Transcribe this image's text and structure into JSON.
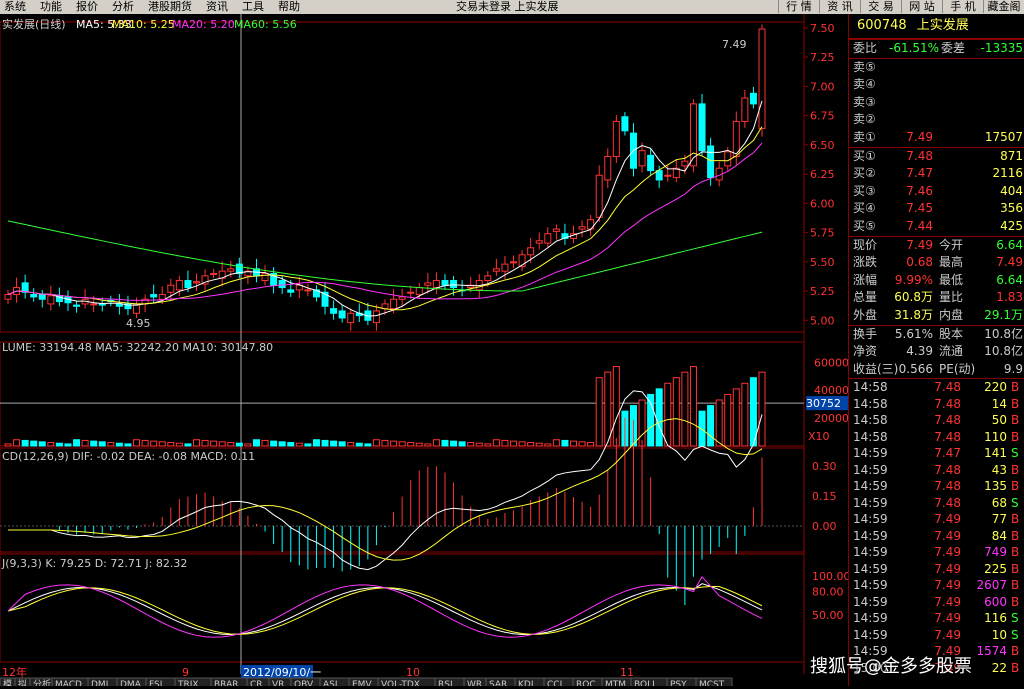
{
  "menubar": {
    "items": [
      "系统",
      "功能",
      "报价",
      "分析",
      "港股期货",
      "资讯",
      "工具",
      "帮助"
    ],
    "status": "交易未登录  上实发展",
    "right_tabs": [
      "行 情",
      "资 讯",
      "交 易",
      "网 站",
      "手 机",
      "藏金阁"
    ]
  },
  "header": {
    "price_line": "实发展(日线) MA5: 5.33  MA10: 5.25  MA20: 5.20  MA60: 5.56",
    "ma5": "MA5: 5.33",
    "ma10": "MA10: 5.25",
    "ma20": "MA20: 5.20",
    "ma60": "MA60: 5.56",
    "vol_line": "LUME: 33194.48  MA5: 32242.20  MA10: 30147.80",
    "macd_line": "CD(12,26,9)  DIF: -0.02  DEA: -0.08  MACD: 0.11",
    "kdj_line": "J(9,3,3)  K: 79.25  D: 72.71  J: 82.32"
  },
  "annotations": {
    "high_label": "7.49",
    "low_label": "4.95",
    "vol_marker": "30752",
    "vol_unit": "X10",
    "cursor_date": "2012/09/10/一"
  },
  "x_labels": [
    "12年",
    "9",
    "10",
    "11"
  ],
  "bottom_tabs": [
    "模",
    "拟",
    "分析",
    "MACD",
    "DMI",
    "DMA",
    "FSL",
    "TRIX",
    "BRAR",
    "CR",
    "VR",
    "OBV",
    "ASI",
    "EMV",
    "VOL-TDX",
    "RSI",
    "WR",
    "SAR",
    "KDJ",
    "CCI",
    "ROC",
    "MTM",
    "BOLL",
    "PSY",
    "MCST"
  ],
  "chart_data": {
    "type": "candlestick",
    "ylim": [
      4.9,
      7.55
    ],
    "yticks": [
      5.0,
      5.25,
      5.5,
      5.75,
      6.0,
      6.25,
      6.5,
      6.75,
      7.0,
      7.25,
      7.5
    ],
    "vol_ticks": [
      20000,
      40000,
      60000
    ],
    "macd_ticks": [
      0.0,
      0.15,
      0.3
    ],
    "kdj_ticks": [
      50.0,
      80.0,
      100.0
    ],
    "close": [
      5.22,
      5.28,
      5.24,
      5.2,
      5.18,
      5.21,
      5.16,
      5.15,
      5.12,
      5.18,
      5.14,
      5.13,
      5.16,
      5.12,
      5.1,
      5.14,
      5.18,
      5.2,
      5.22,
      5.3,
      5.34,
      5.28,
      5.33,
      5.38,
      5.4,
      5.42,
      5.44,
      5.4,
      5.42,
      5.38,
      5.4,
      5.3,
      5.28,
      5.24,
      5.3,
      5.26,
      5.2,
      5.12,
      5.06,
      5.02,
      5.06,
      5.04,
      5.0,
      5.08,
      5.14,
      5.18,
      5.2,
      5.24,
      5.28,
      5.32,
      5.34,
      5.3,
      5.28,
      5.26,
      5.3,
      5.34,
      5.38,
      5.44,
      5.48,
      5.5,
      5.56,
      5.62,
      5.68,
      5.74,
      5.78,
      5.7,
      5.74,
      5.8,
      5.86,
      6.24,
      6.4,
      6.7,
      6.62,
      6.3,
      6.45,
      6.28,
      6.2,
      6.24,
      6.3,
      6.36,
      6.85,
      6.45,
      6.22,
      6.3,
      6.44,
      6.7,
      6.9,
      6.85,
      7.49
    ]
  },
  "quote": {
    "code": "600748",
    "name": "上实发展",
    "weibi_label": "委比",
    "weibi": "-61.51%",
    "weicha_label": "委差",
    "weicha": "-13335",
    "sell": [
      {
        "label": "卖⑤",
        "price": "",
        "vol": ""
      },
      {
        "label": "卖④",
        "price": "",
        "vol": ""
      },
      {
        "label": "卖③",
        "price": "",
        "vol": ""
      },
      {
        "label": "卖②",
        "price": "",
        "vol": ""
      },
      {
        "label": "卖①",
        "price": "7.49",
        "vol": "17507"
      }
    ],
    "buy": [
      {
        "label": "买①",
        "price": "7.48",
        "vol": "871"
      },
      {
        "label": "买②",
        "price": "7.47",
        "vol": "2116"
      },
      {
        "label": "买③",
        "price": "7.46",
        "vol": "404"
      },
      {
        "label": "买④",
        "price": "7.45",
        "vol": "356"
      },
      {
        "label": "买⑤",
        "price": "7.44",
        "vol": "425"
      }
    ],
    "stats": [
      {
        "l1": "现价",
        "v1": "7.49",
        "l2": "今开",
        "v2": "6.64"
      },
      {
        "l1": "涨跌",
        "v1": "0.68",
        "l2": "最高",
        "v2": "7.49"
      },
      {
        "l1": "涨幅",
        "v1": "9.99%",
        "l2": "最低",
        "v2": "6.64"
      },
      {
        "l1": "总量",
        "v1": "60.8万",
        "l2": "量比",
        "v2": "1.83"
      },
      {
        "l1": "外盘",
        "v1": "31.8万",
        "l2": "内盘",
        "v2": "29.1万"
      }
    ],
    "stats2": [
      {
        "l1": "换手",
        "v1": "5.61%",
        "l2": "股本",
        "v2": "10.8亿"
      },
      {
        "l1": "净资",
        "v1": "4.39",
        "l2": "流通",
        "v2": "10.8亿"
      },
      {
        "l1": "收益(三)",
        "v1": "0.566",
        "l2": "PE(动)",
        "v2": "9.9"
      }
    ],
    "ticks": [
      {
        "t": "14:58",
        "p": "7.48",
        "v": "220",
        "s": "B"
      },
      {
        "t": "14:58",
        "p": "7.48",
        "v": "14",
        "s": "B"
      },
      {
        "t": "14:58",
        "p": "7.48",
        "v": "50",
        "s": "B"
      },
      {
        "t": "14:58",
        "p": "7.48",
        "v": "110",
        "s": "B"
      },
      {
        "t": "14:59",
        "p": "7.47",
        "v": "141",
        "s": "S"
      },
      {
        "t": "14:59",
        "p": "7.48",
        "v": "43",
        "s": "B"
      },
      {
        "t": "14:59",
        "p": "7.48",
        "v": "135",
        "s": "B"
      },
      {
        "t": "14:59",
        "p": "7.48",
        "v": "68",
        "s": "S"
      },
      {
        "t": "14:59",
        "p": "7.49",
        "v": "77",
        "s": "B"
      },
      {
        "t": "14:59",
        "p": "7.49",
        "v": "84",
        "s": "B"
      },
      {
        "t": "14:59",
        "p": "7.49",
        "v": "749",
        "s": "B"
      },
      {
        "t": "14:59",
        "p": "7.49",
        "v": "225",
        "s": "B"
      },
      {
        "t": "14:59",
        "p": "7.49",
        "v": "2607",
        "s": "B"
      },
      {
        "t": "14:59",
        "p": "7.49",
        "v": "600",
        "s": "B"
      },
      {
        "t": "14:59",
        "p": "7.49",
        "v": "116",
        "s": "S"
      },
      {
        "t": "14:59",
        "p": "7.49",
        "v": "10",
        "s": "S"
      },
      {
        "t": "14:59",
        "p": "7.49",
        "v": "1574",
        "s": "B"
      },
      {
        "t": "15:00",
        "p": "7.49",
        "v": "22",
        "s": "B"
      }
    ]
  },
  "watermark": "搜狐号@金多多股票"
}
